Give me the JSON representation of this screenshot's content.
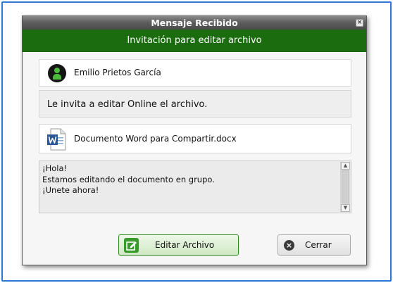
{
  "window": {
    "title": "Mensaje Recibido",
    "close_glyph": "×"
  },
  "header": {
    "title": "Invitación para editar archivo"
  },
  "sender": {
    "name": "Emilio Prietos García",
    "icon": "user-icon",
    "icon_color": "#4cba3c"
  },
  "invite": {
    "text": "Le invita a editar Online el archivo."
  },
  "file": {
    "name": "Documento Word para Compartir.docx",
    "icon": "word-document-icon",
    "icon_color": "#2b5797"
  },
  "message": {
    "lines": [
      "¡Hola!",
      "Estamos editando el documento en grupo.",
      "¡Unete ahora!"
    ]
  },
  "buttons": {
    "edit": {
      "label": "Editar Archivo",
      "icon": "edit-icon",
      "color": "#3a9a2b"
    },
    "close": {
      "label": "Cerrar",
      "icon": "close-circle-icon"
    }
  },
  "colors": {
    "header_bg": "#1b6b0f",
    "frame": "#2f78d3"
  }
}
